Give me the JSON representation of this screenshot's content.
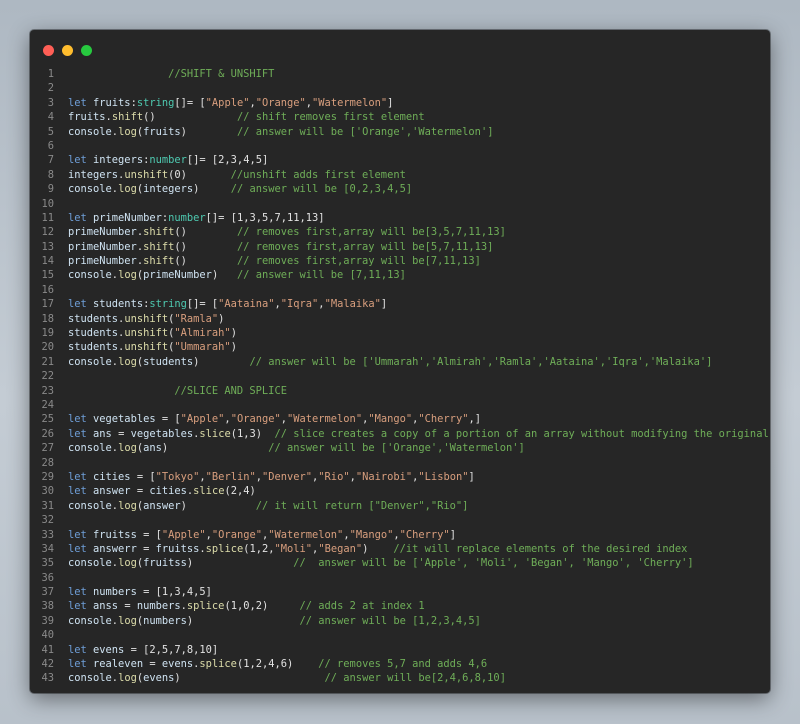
{
  "window": {
    "controls": [
      "close",
      "minimize",
      "maximize"
    ],
    "colors": {
      "close": "#ff5f56",
      "minimize": "#ffbd2e",
      "maximize": "#27c93f"
    }
  },
  "code": {
    "language": "typescript",
    "lines": [
      {
        "n": "1",
        "t": [
          [
            "c",
            "                //SHIFT & UNSHIFT"
          ]
        ]
      },
      {
        "n": "2",
        "t": []
      },
      {
        "n": "3",
        "t": [
          [
            "k",
            "let "
          ],
          [
            "v",
            "fruits"
          ],
          [
            "p",
            ":"
          ],
          [
            "y",
            "string"
          ],
          [
            "p",
            "[]= ["
          ],
          [
            "s",
            "\"Apple\""
          ],
          [
            "p",
            ","
          ],
          [
            "s",
            "\"Orange\""
          ],
          [
            "p",
            ","
          ],
          [
            "s",
            "\"Watermelon\""
          ],
          [
            "p",
            "]"
          ]
        ]
      },
      {
        "n": "4",
        "t": [
          [
            "v",
            "fruits"
          ],
          [
            "p",
            "."
          ],
          [
            "f",
            "shift"
          ],
          [
            "p",
            "()             "
          ],
          [
            "c",
            "// shift removes first element"
          ]
        ]
      },
      {
        "n": "5",
        "t": [
          [
            "v",
            "console"
          ],
          [
            "p",
            "."
          ],
          [
            "f",
            "log"
          ],
          [
            "p",
            "("
          ],
          [
            "v",
            "fruits"
          ],
          [
            "p",
            ")        "
          ],
          [
            "c",
            "// answer will be ['Orange','Watermelon']"
          ]
        ]
      },
      {
        "n": "6",
        "t": []
      },
      {
        "n": "7",
        "t": [
          [
            "k",
            "let "
          ],
          [
            "v",
            "integers"
          ],
          [
            "p",
            ":"
          ],
          [
            "y",
            "number"
          ],
          [
            "p",
            "[]= [2,3,4,5]"
          ]
        ]
      },
      {
        "n": "8",
        "t": [
          [
            "v",
            "integers"
          ],
          [
            "p",
            "."
          ],
          [
            "f",
            "unshift"
          ],
          [
            "p",
            "(0)       "
          ],
          [
            "c",
            "//unshift adds first element"
          ]
        ]
      },
      {
        "n": "9",
        "t": [
          [
            "v",
            "console"
          ],
          [
            "p",
            "."
          ],
          [
            "f",
            "log"
          ],
          [
            "p",
            "("
          ],
          [
            "v",
            "integers"
          ],
          [
            "p",
            ")     "
          ],
          [
            "c",
            "// answer will be [0,2,3,4,5]"
          ]
        ]
      },
      {
        "n": "10",
        "t": []
      },
      {
        "n": "11",
        "t": [
          [
            "k",
            "let "
          ],
          [
            "v",
            "primeNumber"
          ],
          [
            "p",
            ":"
          ],
          [
            "y",
            "number"
          ],
          [
            "p",
            "[]= [1,3,5,7,11,13]"
          ]
        ]
      },
      {
        "n": "12",
        "t": [
          [
            "v",
            "primeNumber"
          ],
          [
            "p",
            "."
          ],
          [
            "f",
            "shift"
          ],
          [
            "p",
            "()        "
          ],
          [
            "c",
            "// removes first,array will be[3,5,7,11,13]"
          ]
        ]
      },
      {
        "n": "13",
        "t": [
          [
            "v",
            "primeNumber"
          ],
          [
            "p",
            "."
          ],
          [
            "f",
            "shift"
          ],
          [
            "p",
            "()        "
          ],
          [
            "c",
            "// removes first,array will be[5,7,11,13]"
          ]
        ]
      },
      {
        "n": "14",
        "t": [
          [
            "v",
            "primeNumber"
          ],
          [
            "p",
            "."
          ],
          [
            "f",
            "shift"
          ],
          [
            "p",
            "()        "
          ],
          [
            "c",
            "// removes first,array will be[7,11,13]"
          ]
        ]
      },
      {
        "n": "15",
        "t": [
          [
            "v",
            "console"
          ],
          [
            "p",
            "."
          ],
          [
            "f",
            "log"
          ],
          [
            "p",
            "("
          ],
          [
            "v",
            "primeNumber"
          ],
          [
            "p",
            ")   "
          ],
          [
            "c",
            "// answer will be [7,11,13]"
          ]
        ]
      },
      {
        "n": "16",
        "t": []
      },
      {
        "n": "17",
        "t": [
          [
            "k",
            "let "
          ],
          [
            "v",
            "students"
          ],
          [
            "p",
            ":"
          ],
          [
            "y",
            "string"
          ],
          [
            "p",
            "[]= ["
          ],
          [
            "s",
            "\"Aataina\""
          ],
          [
            "p",
            ","
          ],
          [
            "s",
            "\"Iqra\""
          ],
          [
            "p",
            ","
          ],
          [
            "s",
            "\"Malaika\""
          ],
          [
            "p",
            "]"
          ]
        ]
      },
      {
        "n": "18",
        "t": [
          [
            "v",
            "students"
          ],
          [
            "p",
            "."
          ],
          [
            "f",
            "unshift"
          ],
          [
            "p",
            "("
          ],
          [
            "s",
            "\"Ramla\""
          ],
          [
            "p",
            ")"
          ]
        ]
      },
      {
        "n": "19",
        "t": [
          [
            "v",
            "students"
          ],
          [
            "p",
            "."
          ],
          [
            "f",
            "unshift"
          ],
          [
            "p",
            "("
          ],
          [
            "s",
            "\"Almirah\""
          ],
          [
            "p",
            ")"
          ]
        ]
      },
      {
        "n": "20",
        "t": [
          [
            "v",
            "students"
          ],
          [
            "p",
            "."
          ],
          [
            "f",
            "unshift"
          ],
          [
            "p",
            "("
          ],
          [
            "s",
            "\"Ummarah\""
          ],
          [
            "p",
            ")"
          ]
        ]
      },
      {
        "n": "21",
        "t": [
          [
            "v",
            "console"
          ],
          [
            "p",
            "."
          ],
          [
            "f",
            "log"
          ],
          [
            "p",
            "("
          ],
          [
            "v",
            "students"
          ],
          [
            "p",
            ")        "
          ],
          [
            "c",
            "// answer will be ['Ummarah','Almirah','Ramla','Aataina','Iqra','Malaika']"
          ]
        ]
      },
      {
        "n": "22",
        "t": []
      },
      {
        "n": "23",
        "t": [
          [
            "c",
            "                 //SLICE AND SPLICE"
          ]
        ]
      },
      {
        "n": "24",
        "t": []
      },
      {
        "n": "25",
        "t": [
          [
            "k",
            "let "
          ],
          [
            "v",
            "vegetables"
          ],
          [
            "p",
            " = ["
          ],
          [
            "s",
            "\"Apple\""
          ],
          [
            "p",
            ","
          ],
          [
            "s",
            "\"Orange\""
          ],
          [
            "p",
            ","
          ],
          [
            "s",
            "\"Watermelon\""
          ],
          [
            "p",
            ","
          ],
          [
            "s",
            "\"Mango\""
          ],
          [
            "p",
            ","
          ],
          [
            "s",
            "\"Cherry\""
          ],
          [
            "p",
            ",]"
          ]
        ]
      },
      {
        "n": "26",
        "t": [
          [
            "k",
            "let "
          ],
          [
            "v",
            "ans"
          ],
          [
            "p",
            " = "
          ],
          [
            "v",
            "vegetables"
          ],
          [
            "p",
            "."
          ],
          [
            "f",
            "slice"
          ],
          [
            "p",
            "(1,3)  "
          ],
          [
            "c",
            "// slice creates a copy of a portion of an array without modifying the original array"
          ]
        ]
      },
      {
        "n": "27",
        "t": [
          [
            "v",
            "console"
          ],
          [
            "p",
            "."
          ],
          [
            "f",
            "log"
          ],
          [
            "p",
            "("
          ],
          [
            "v",
            "ans"
          ],
          [
            "p",
            ")                "
          ],
          [
            "c",
            "// answer will be ['Orange','Watermelon']"
          ]
        ]
      },
      {
        "n": "28",
        "t": []
      },
      {
        "n": "29",
        "t": [
          [
            "k",
            "let "
          ],
          [
            "v",
            "cities"
          ],
          [
            "p",
            " = ["
          ],
          [
            "s",
            "\"Tokyo\""
          ],
          [
            "p",
            ","
          ],
          [
            "s",
            "\"Berlin\""
          ],
          [
            "p",
            ","
          ],
          [
            "s",
            "\"Denver\""
          ],
          [
            "p",
            ","
          ],
          [
            "s",
            "\"Rio\""
          ],
          [
            "p",
            ","
          ],
          [
            "s",
            "\"Nairobi\""
          ],
          [
            "p",
            ","
          ],
          [
            "s",
            "\"Lisbon\""
          ],
          [
            "p",
            "]"
          ]
        ]
      },
      {
        "n": "30",
        "t": [
          [
            "k",
            "let "
          ],
          [
            "v",
            "answer"
          ],
          [
            "p",
            " = "
          ],
          [
            "v",
            "cities"
          ],
          [
            "p",
            "."
          ],
          [
            "f",
            "slice"
          ],
          [
            "p",
            "(2,4)"
          ]
        ]
      },
      {
        "n": "31",
        "t": [
          [
            "v",
            "console"
          ],
          [
            "p",
            "."
          ],
          [
            "f",
            "log"
          ],
          [
            "p",
            "("
          ],
          [
            "v",
            "answer"
          ],
          [
            "p",
            ")           "
          ],
          [
            "c",
            "// it will return [\"Denver\",\"Rio\"]"
          ]
        ]
      },
      {
        "n": "32",
        "t": []
      },
      {
        "n": "33",
        "t": [
          [
            "k",
            "let "
          ],
          [
            "v",
            "fruitss"
          ],
          [
            "p",
            " = ["
          ],
          [
            "s",
            "\"Apple\""
          ],
          [
            "p",
            ","
          ],
          [
            "s",
            "\"Orange\""
          ],
          [
            "p",
            ","
          ],
          [
            "s",
            "\"Watermelon\""
          ],
          [
            "p",
            ","
          ],
          [
            "s",
            "\"Mango\""
          ],
          [
            "p",
            ","
          ],
          [
            "s",
            "\"Cherry\""
          ],
          [
            "p",
            "]"
          ]
        ]
      },
      {
        "n": "34",
        "t": [
          [
            "k",
            "let "
          ],
          [
            "v",
            "answerr"
          ],
          [
            "p",
            " = "
          ],
          [
            "v",
            "fruitss"
          ],
          [
            "p",
            "."
          ],
          [
            "f",
            "splice"
          ],
          [
            "p",
            "(1,2,"
          ],
          [
            "s",
            "\"Moli\""
          ],
          [
            "p",
            ","
          ],
          [
            "s",
            "\"Began\""
          ],
          [
            "p",
            ")    "
          ],
          [
            "c",
            "//it will replace elements of the desired index"
          ]
        ]
      },
      {
        "n": "35",
        "t": [
          [
            "v",
            "console"
          ],
          [
            "p",
            "."
          ],
          [
            "f",
            "log"
          ],
          [
            "p",
            "("
          ],
          [
            "v",
            "fruitss"
          ],
          [
            "p",
            ")                "
          ],
          [
            "c",
            "//  answer will be ['Apple', 'Moli', 'Began', 'Mango', 'Cherry']"
          ]
        ]
      },
      {
        "n": "36",
        "t": []
      },
      {
        "n": "37",
        "t": [
          [
            "k",
            "let "
          ],
          [
            "v",
            "numbers"
          ],
          [
            "p",
            " = [1,3,4,5]"
          ]
        ]
      },
      {
        "n": "38",
        "t": [
          [
            "k",
            "let "
          ],
          [
            "v",
            "anss"
          ],
          [
            "p",
            " = "
          ],
          [
            "v",
            "numbers"
          ],
          [
            "p",
            "."
          ],
          [
            "f",
            "splice"
          ],
          [
            "p",
            "(1,0,2)     "
          ],
          [
            "c",
            "// adds 2 at index 1"
          ]
        ]
      },
      {
        "n": "39",
        "t": [
          [
            "v",
            "console"
          ],
          [
            "p",
            "."
          ],
          [
            "f",
            "log"
          ],
          [
            "p",
            "("
          ],
          [
            "v",
            "numbers"
          ],
          [
            "p",
            ")                 "
          ],
          [
            "c",
            "// answer will be [1,2,3,4,5]"
          ]
        ]
      },
      {
        "n": "40",
        "t": []
      },
      {
        "n": "41",
        "t": [
          [
            "k",
            "let "
          ],
          [
            "v",
            "evens"
          ],
          [
            "p",
            " = [2,5,7,8,10]"
          ]
        ]
      },
      {
        "n": "42",
        "t": [
          [
            "k",
            "let "
          ],
          [
            "v",
            "realeven"
          ],
          [
            "p",
            " = "
          ],
          [
            "v",
            "evens"
          ],
          [
            "p",
            "."
          ],
          [
            "f",
            "splice"
          ],
          [
            "p",
            "(1,2,4,6)    "
          ],
          [
            "c",
            "// removes 5,7 and adds 4,6"
          ]
        ]
      },
      {
        "n": "43",
        "t": [
          [
            "v",
            "console"
          ],
          [
            "p",
            "."
          ],
          [
            "f",
            "log"
          ],
          [
            "p",
            "("
          ],
          [
            "v",
            "evens"
          ],
          [
            "p",
            ")                       "
          ],
          [
            "c",
            "// answer will be[2,4,6,8,10]"
          ]
        ]
      }
    ]
  }
}
